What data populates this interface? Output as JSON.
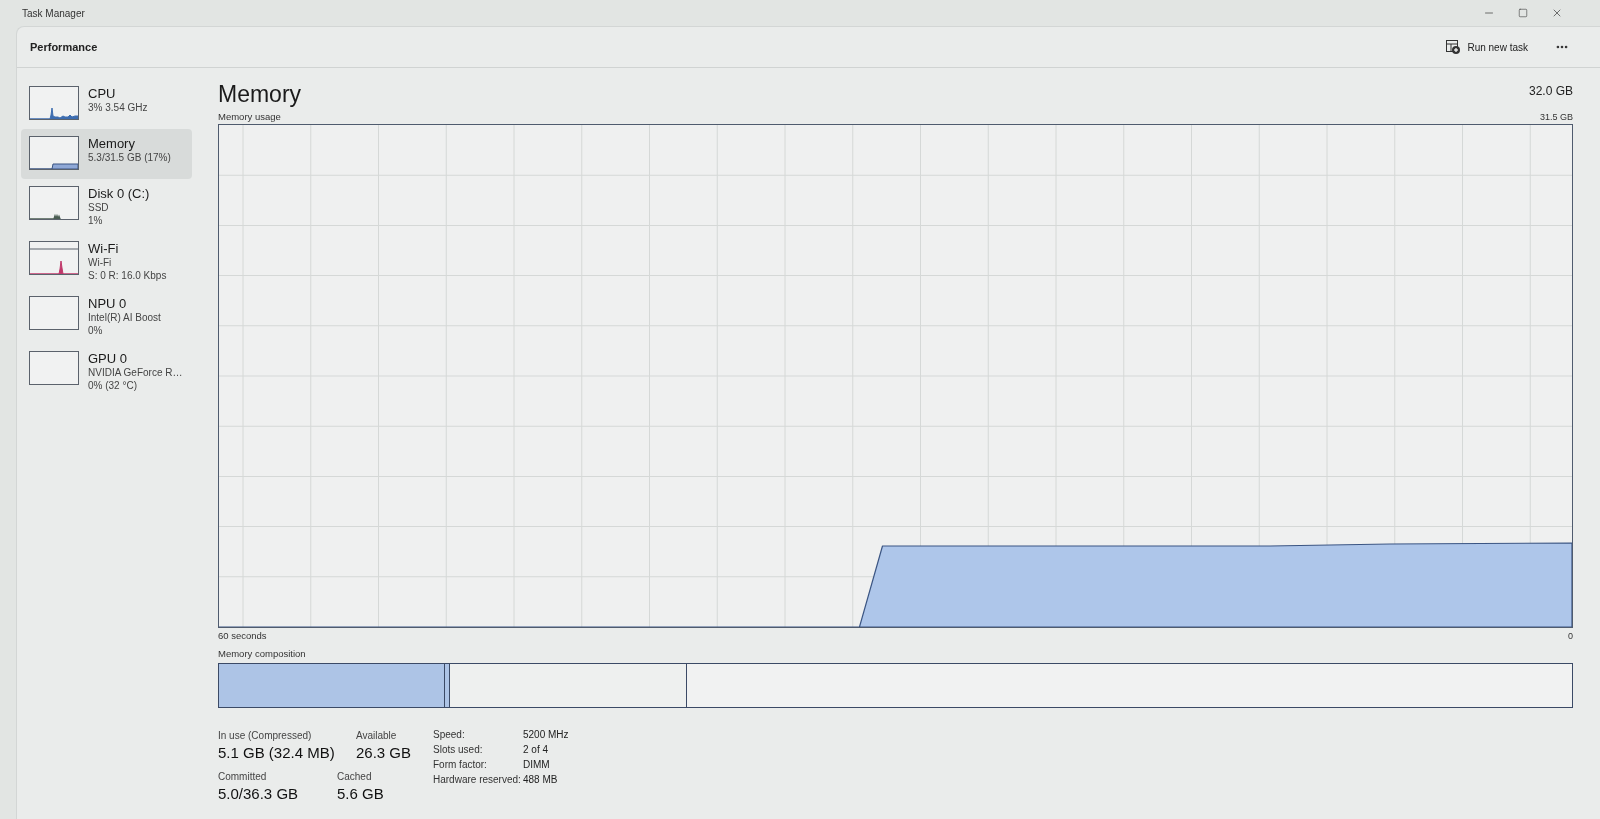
{
  "window": {
    "title": "Task Manager"
  },
  "header": {
    "title": "Performance",
    "run_new_task": "Run new task"
  },
  "sidebar": {
    "items": [
      {
        "kind": "cpu",
        "name": "CPU",
        "details": [
          "3% 3.54 GHz"
        ],
        "selected": false,
        "color": "#3d6db0"
      },
      {
        "kind": "memory",
        "name": "Memory",
        "details": [
          "5.3/31.5 GB (17%)"
        ],
        "selected": true,
        "color": "#8fa8d6"
      },
      {
        "kind": "disk",
        "name": "Disk 0 (C:)",
        "details": [
          "SSD",
          "1%"
        ],
        "selected": false,
        "color": "#4a5d52"
      },
      {
        "kind": "network",
        "name": "Wi-Fi",
        "details": [
          "Wi-Fi",
          "S: 0 R: 16.0 Kbps"
        ],
        "selected": false,
        "color": "#c0396b"
      },
      {
        "kind": "npu",
        "name": "NPU 0",
        "details": [
          "Intel(R) AI Boost",
          "0%"
        ],
        "selected": false
      },
      {
        "kind": "gpu",
        "name": "GPU 0",
        "details": [
          "NVIDIA GeForce R…",
          "0% (32 °C)"
        ],
        "selected": false
      }
    ]
  },
  "performance": {
    "title": "Memory",
    "total": "32.0 GB",
    "usage_graph": {
      "title": "Memory usage",
      "max_label": "31.5 GB",
      "span_label": "60 seconds",
      "min_label": "0"
    },
    "composition": {
      "label": "Memory composition",
      "segments": [
        {
          "kind": "in_use",
          "level": 0.166
        },
        {
          "kind": "modified",
          "level": 0.004
        },
        {
          "kind": "standby",
          "level": 0.175
        },
        {
          "kind": "free",
          "level": 0.655
        }
      ]
    },
    "stats": [
      {
        "label": "In use (Compressed)",
        "value": "5.1 GB (32.4 MB)"
      },
      {
        "label": "Available",
        "value": "26.3 GB"
      },
      {
        "label": "Committed",
        "value": "5.0/36.3 GB"
      },
      {
        "label": "Cached",
        "value": "5.6 GB"
      }
    ],
    "details": [
      {
        "label": "Speed:",
        "value": "5200 MHz"
      },
      {
        "label": "Slots used:",
        "value": "2 of 4"
      },
      {
        "label": "Form factor:",
        "value": "DIMM"
      },
      {
        "label": "Hardware reserved:",
        "value": "488 MB"
      }
    ]
  }
}
